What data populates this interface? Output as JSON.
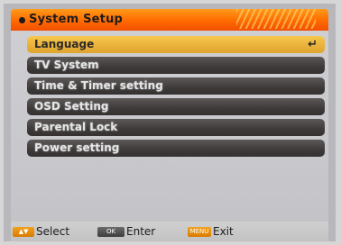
{
  "header": {
    "title": "System Setup"
  },
  "menu": {
    "items": [
      {
        "label": "Language"
      },
      {
        "label": "TV System"
      },
      {
        "label": "Time & Timer setting"
      },
      {
        "label": "OSD Setting"
      },
      {
        "label": "Parental Lock"
      },
      {
        "label": "Power setting"
      }
    ],
    "selected_index": 0
  },
  "footer": {
    "select_label": "Select",
    "enter_label": "Enter",
    "exit_label": "Exit",
    "menu_key_text": "MENU",
    "ok_key_text": "OK"
  },
  "colors": {
    "header_orange": "#ff6a00",
    "selected_yellow": "#eab23a",
    "item_dark": "#3e3a3a"
  },
  "icons": {
    "enter": "return-arrow-icon",
    "bullet": "bullet-icon"
  }
}
